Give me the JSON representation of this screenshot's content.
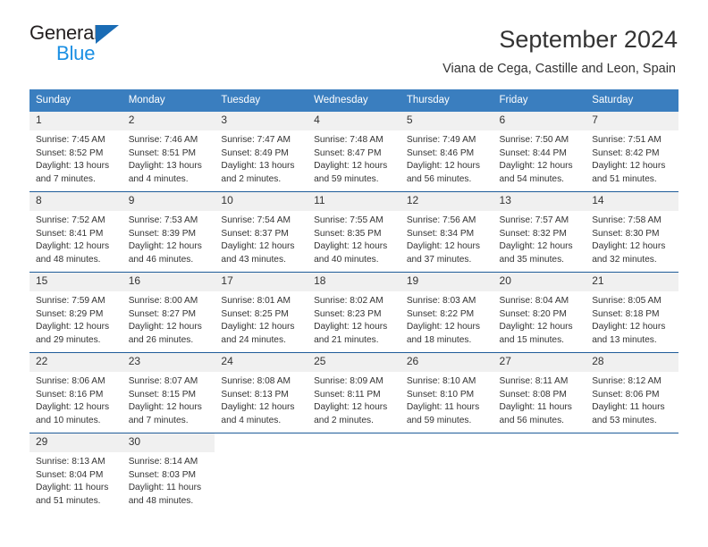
{
  "brand": {
    "name_top": "General",
    "name_bottom": "Blue",
    "triangle_color": "#1a6cb5",
    "blue_text_color": "#1a8fe3"
  },
  "header": {
    "title": "September 2024",
    "subtitle": "Viana de Cega, Castille and Leon, Spain"
  },
  "theme": {
    "header_row_bg": "#3a7ebf",
    "row_divider": "#1f5c99",
    "daynum_bg": "#f0f0f0",
    "text": "#333333"
  },
  "weekday_headers": [
    "Sunday",
    "Monday",
    "Tuesday",
    "Wednesday",
    "Thursday",
    "Friday",
    "Saturday"
  ],
  "weeks": [
    [
      {
        "day": "1",
        "sunrise": "Sunrise: 7:45 AM",
        "sunset": "Sunset: 8:52 PM",
        "daylight": "Daylight: 13 hours and 7 minutes."
      },
      {
        "day": "2",
        "sunrise": "Sunrise: 7:46 AM",
        "sunset": "Sunset: 8:51 PM",
        "daylight": "Daylight: 13 hours and 4 minutes."
      },
      {
        "day": "3",
        "sunrise": "Sunrise: 7:47 AM",
        "sunset": "Sunset: 8:49 PM",
        "daylight": "Daylight: 13 hours and 2 minutes."
      },
      {
        "day": "4",
        "sunrise": "Sunrise: 7:48 AM",
        "sunset": "Sunset: 8:47 PM",
        "daylight": "Daylight: 12 hours and 59 minutes."
      },
      {
        "day": "5",
        "sunrise": "Sunrise: 7:49 AM",
        "sunset": "Sunset: 8:46 PM",
        "daylight": "Daylight: 12 hours and 56 minutes."
      },
      {
        "day": "6",
        "sunrise": "Sunrise: 7:50 AM",
        "sunset": "Sunset: 8:44 PM",
        "daylight": "Daylight: 12 hours and 54 minutes."
      },
      {
        "day": "7",
        "sunrise": "Sunrise: 7:51 AM",
        "sunset": "Sunset: 8:42 PM",
        "daylight": "Daylight: 12 hours and 51 minutes."
      }
    ],
    [
      {
        "day": "8",
        "sunrise": "Sunrise: 7:52 AM",
        "sunset": "Sunset: 8:41 PM",
        "daylight": "Daylight: 12 hours and 48 minutes."
      },
      {
        "day": "9",
        "sunrise": "Sunrise: 7:53 AM",
        "sunset": "Sunset: 8:39 PM",
        "daylight": "Daylight: 12 hours and 46 minutes."
      },
      {
        "day": "10",
        "sunrise": "Sunrise: 7:54 AM",
        "sunset": "Sunset: 8:37 PM",
        "daylight": "Daylight: 12 hours and 43 minutes."
      },
      {
        "day": "11",
        "sunrise": "Sunrise: 7:55 AM",
        "sunset": "Sunset: 8:35 PM",
        "daylight": "Daylight: 12 hours and 40 minutes."
      },
      {
        "day": "12",
        "sunrise": "Sunrise: 7:56 AM",
        "sunset": "Sunset: 8:34 PM",
        "daylight": "Daylight: 12 hours and 37 minutes."
      },
      {
        "day": "13",
        "sunrise": "Sunrise: 7:57 AM",
        "sunset": "Sunset: 8:32 PM",
        "daylight": "Daylight: 12 hours and 35 minutes."
      },
      {
        "day": "14",
        "sunrise": "Sunrise: 7:58 AM",
        "sunset": "Sunset: 8:30 PM",
        "daylight": "Daylight: 12 hours and 32 minutes."
      }
    ],
    [
      {
        "day": "15",
        "sunrise": "Sunrise: 7:59 AM",
        "sunset": "Sunset: 8:29 PM",
        "daylight": "Daylight: 12 hours and 29 minutes."
      },
      {
        "day": "16",
        "sunrise": "Sunrise: 8:00 AM",
        "sunset": "Sunset: 8:27 PM",
        "daylight": "Daylight: 12 hours and 26 minutes."
      },
      {
        "day": "17",
        "sunrise": "Sunrise: 8:01 AM",
        "sunset": "Sunset: 8:25 PM",
        "daylight": "Daylight: 12 hours and 24 minutes."
      },
      {
        "day": "18",
        "sunrise": "Sunrise: 8:02 AM",
        "sunset": "Sunset: 8:23 PM",
        "daylight": "Daylight: 12 hours and 21 minutes."
      },
      {
        "day": "19",
        "sunrise": "Sunrise: 8:03 AM",
        "sunset": "Sunset: 8:22 PM",
        "daylight": "Daylight: 12 hours and 18 minutes."
      },
      {
        "day": "20",
        "sunrise": "Sunrise: 8:04 AM",
        "sunset": "Sunset: 8:20 PM",
        "daylight": "Daylight: 12 hours and 15 minutes."
      },
      {
        "day": "21",
        "sunrise": "Sunrise: 8:05 AM",
        "sunset": "Sunset: 8:18 PM",
        "daylight": "Daylight: 12 hours and 13 minutes."
      }
    ],
    [
      {
        "day": "22",
        "sunrise": "Sunrise: 8:06 AM",
        "sunset": "Sunset: 8:16 PM",
        "daylight": "Daylight: 12 hours and 10 minutes."
      },
      {
        "day": "23",
        "sunrise": "Sunrise: 8:07 AM",
        "sunset": "Sunset: 8:15 PM",
        "daylight": "Daylight: 12 hours and 7 minutes."
      },
      {
        "day": "24",
        "sunrise": "Sunrise: 8:08 AM",
        "sunset": "Sunset: 8:13 PM",
        "daylight": "Daylight: 12 hours and 4 minutes."
      },
      {
        "day": "25",
        "sunrise": "Sunrise: 8:09 AM",
        "sunset": "Sunset: 8:11 PM",
        "daylight": "Daylight: 12 hours and 2 minutes."
      },
      {
        "day": "26",
        "sunrise": "Sunrise: 8:10 AM",
        "sunset": "Sunset: 8:10 PM",
        "daylight": "Daylight: 11 hours and 59 minutes."
      },
      {
        "day": "27",
        "sunrise": "Sunrise: 8:11 AM",
        "sunset": "Sunset: 8:08 PM",
        "daylight": "Daylight: 11 hours and 56 minutes."
      },
      {
        "day": "28",
        "sunrise": "Sunrise: 8:12 AM",
        "sunset": "Sunset: 8:06 PM",
        "daylight": "Daylight: 11 hours and 53 minutes."
      }
    ],
    [
      {
        "day": "29",
        "sunrise": "Sunrise: 8:13 AM",
        "sunset": "Sunset: 8:04 PM",
        "daylight": "Daylight: 11 hours and 51 minutes."
      },
      {
        "day": "30",
        "sunrise": "Sunrise: 8:14 AM",
        "sunset": "Sunset: 8:03 PM",
        "daylight": "Daylight: 11 hours and 48 minutes."
      },
      {
        "day": "",
        "sunrise": "",
        "sunset": "",
        "daylight": ""
      },
      {
        "day": "",
        "sunrise": "",
        "sunset": "",
        "daylight": ""
      },
      {
        "day": "",
        "sunrise": "",
        "sunset": "",
        "daylight": ""
      },
      {
        "day": "",
        "sunrise": "",
        "sunset": "",
        "daylight": ""
      },
      {
        "day": "",
        "sunrise": "",
        "sunset": "",
        "daylight": ""
      }
    ]
  ]
}
